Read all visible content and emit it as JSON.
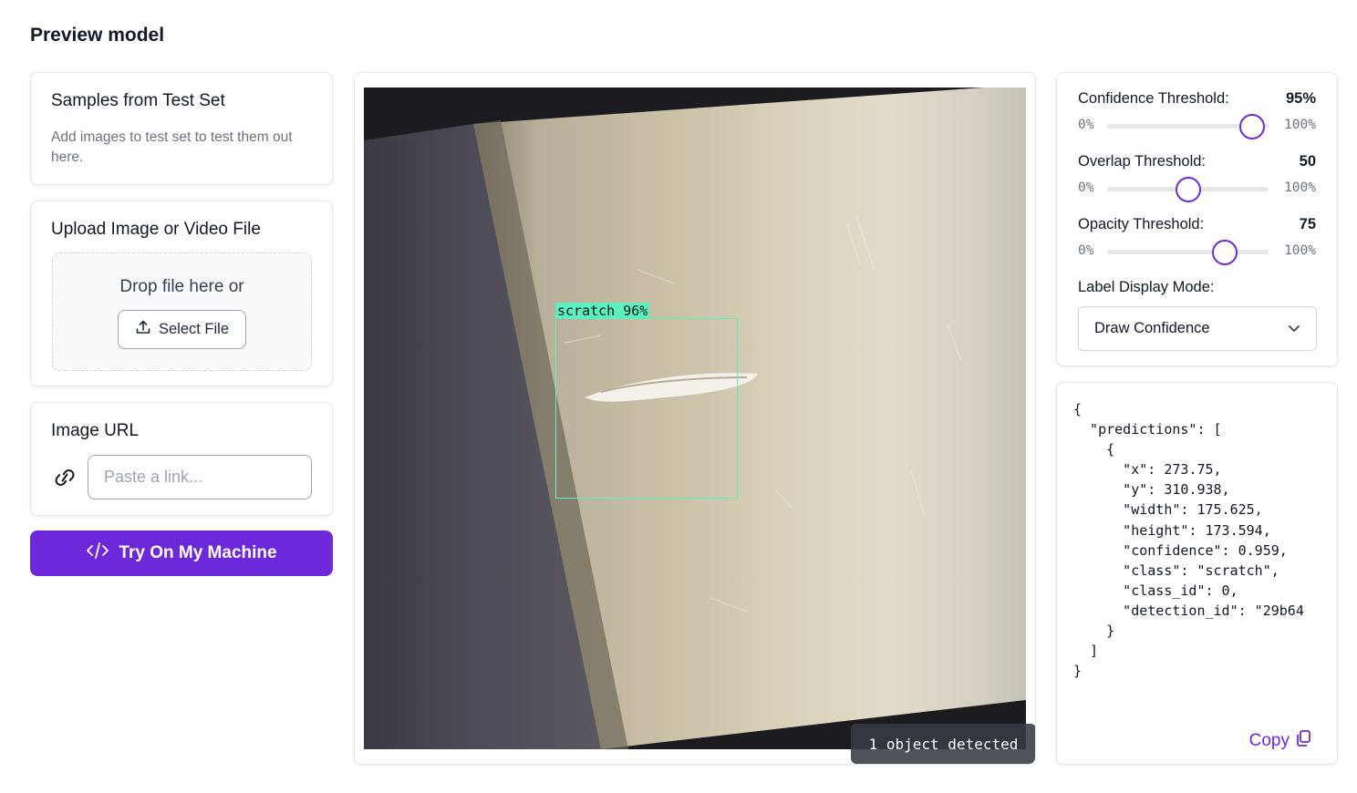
{
  "page": {
    "title": "Preview model"
  },
  "samples": {
    "title": "Samples from Test Set",
    "description": "Add images to test set to test them out here."
  },
  "upload": {
    "title": "Upload Image or Video File",
    "drop_text": "Drop file here or",
    "select_label": "Select File"
  },
  "image_url": {
    "title": "Image URL",
    "placeholder": "Paste a link..."
  },
  "try_button": {
    "label": "Try On My Machine"
  },
  "viewer": {
    "detection_label": "scratch 96%",
    "status": "1 object detected"
  },
  "settings": {
    "thresholds": [
      {
        "label": "Confidence Threshold:",
        "value": "95%",
        "min_label": "0%",
        "max_label": "100%",
        "level": 0.9
      },
      {
        "label": "Overlap Threshold:",
        "value": "50",
        "min_label": "0%",
        "max_label": "100%",
        "level": 0.5
      },
      {
        "label": "Opacity Threshold:",
        "value": "75",
        "min_label": "0%",
        "max_label": "100%",
        "level": 0.73
      }
    ],
    "label_mode_label": "Label Display Mode:",
    "label_mode_value": "Draw Confidence"
  },
  "json_output": {
    "text": "{\n  \"predictions\": [\n    {\n      \"x\": 273.75,\n      \"y\": 310.938,\n      \"width\": 175.625,\n      \"height\": 173.594,\n      \"confidence\": 0.959,\n      \"class\": \"scratch\",\n      \"class_id\": 0,\n      \"detection_id\": \"29b64\n    }\n  ]\n}",
    "copy_label": "Copy"
  },
  "colors": {
    "accent": "#6d28d9",
    "bbox": "#5cf0c0"
  }
}
